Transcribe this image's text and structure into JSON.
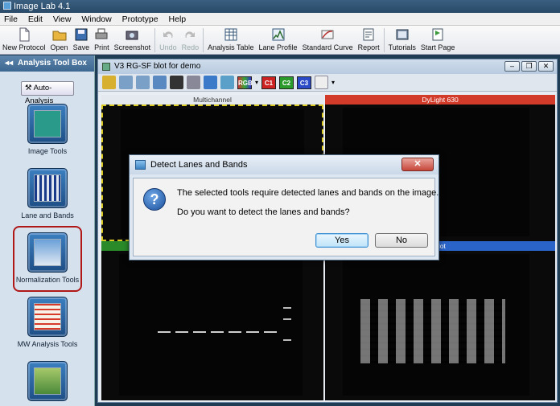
{
  "app": {
    "title": "Image Lab 4.1"
  },
  "menu": [
    "File",
    "Edit",
    "View",
    "Window",
    "Prototype",
    "Help"
  ],
  "toolbar": [
    {
      "label": "New Protocol",
      "icon": "new-document-icon",
      "enabled": true
    },
    {
      "label": "Open",
      "icon": "folder-open-icon",
      "enabled": true
    },
    {
      "label": "Save",
      "icon": "floppy-disk-icon",
      "enabled": true
    },
    {
      "label": "Print",
      "icon": "printer-icon",
      "enabled": true
    },
    {
      "label": "Screenshot",
      "icon": "camera-icon",
      "enabled": true
    },
    {
      "label": "Undo",
      "icon": "undo-icon",
      "enabled": false
    },
    {
      "label": "Redo",
      "icon": "redo-icon",
      "enabled": false
    },
    {
      "label": "Analysis Table",
      "icon": "table-icon",
      "enabled": true
    },
    {
      "label": "Lane Profile",
      "icon": "lane-profile-icon",
      "enabled": true
    },
    {
      "label": "Standard Curve",
      "icon": "curve-icon",
      "enabled": true
    },
    {
      "label": "Report",
      "icon": "report-icon",
      "enabled": true
    },
    {
      "label": "Tutorials",
      "icon": "tutorials-icon",
      "enabled": true
    },
    {
      "label": "Start Page",
      "icon": "start-page-icon",
      "enabled": true
    }
  ],
  "left_panel": {
    "header": "Analysis Tool Box",
    "collapse_glyph": "◂◂",
    "auto_analysis": "Auto-Analysis",
    "tools": [
      "Image Tools",
      "Lane and Bands",
      "Normalization Tools",
      "MW Analysis Tools"
    ],
    "highlighted_tool": "Normalization Tools"
  },
  "document": {
    "title": "V3 RG-SF blot for demo",
    "channels": [
      "RGB",
      "C1",
      "C2",
      "C3"
    ],
    "panels": [
      "Multichannel",
      "DyLight 630",
      "",
      "blot"
    ],
    "colors": {
      "dylight": "#d23a2a",
      "green": "#2a8a2a",
      "blue": "#2a64c8",
      "selection": "#d8c820"
    }
  },
  "dialog": {
    "title": "Detect Lanes and Bands",
    "message1": "The selected tools require detected lanes and bands on the image.",
    "message2": "Do you want to detect the lanes and bands?",
    "yes": "Yes",
    "no": "No",
    "close": "✕"
  }
}
